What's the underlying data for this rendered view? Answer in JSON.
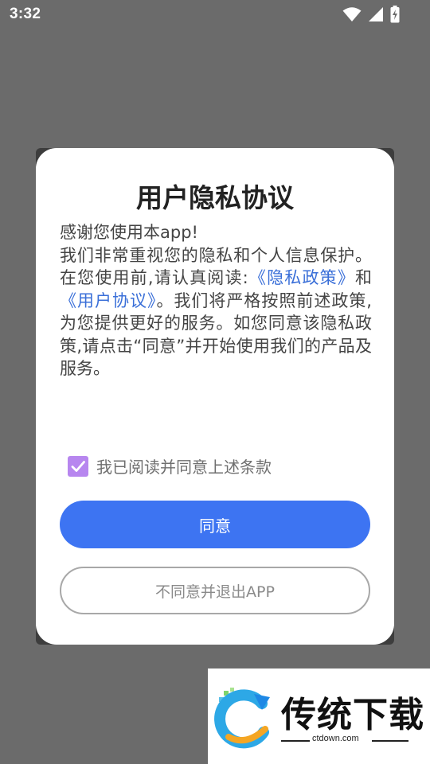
{
  "status_bar": {
    "time": "3:32",
    "icons": [
      "wifi-icon",
      "cellular-signal-icon",
      "battery-charging-icon"
    ]
  },
  "dialog": {
    "title": "用户隐私协议",
    "body": {
      "greeting": "感谢您使用本app!",
      "text_before_links": "我们非常重视您的隐私和个人信息保护。在您使用前,请认真阅读:",
      "privacy_policy_link": "《隐私政策》",
      "and": "和",
      "user_agreement_link": "《用户协议》",
      "text_after_links": "。我们将严格按照前述政策,为您提供更好的服务。如您同意该隐私政策,请点击“同意”并开始使用我们的产品及服务。"
    },
    "consent": {
      "checked": true,
      "label": "我已阅读并同意上述条款"
    },
    "agree_button": "同意",
    "decline_button": "不同意并退出APP"
  },
  "watermark": {
    "brand": "传统下载",
    "domain": "ctdown.com"
  },
  "colors": {
    "overlay": "#6b6b6b",
    "link": "#3a6fd8",
    "primary_button": "#3d74f2",
    "checkbox": "#b786ef"
  }
}
